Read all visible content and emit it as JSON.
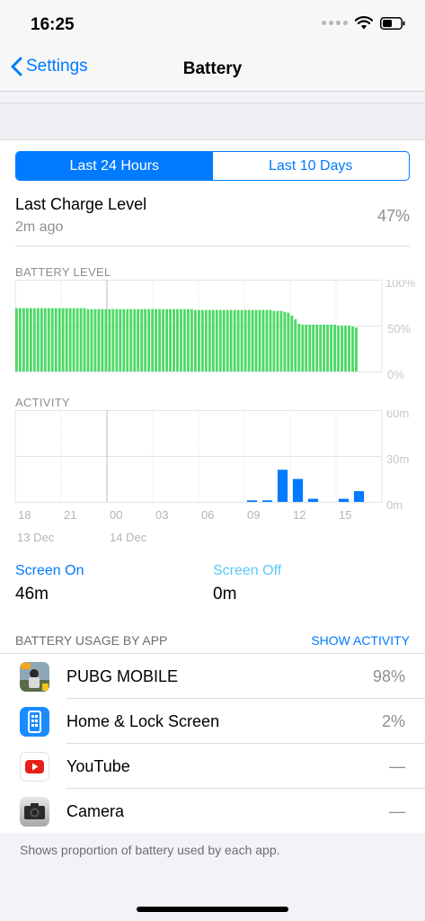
{
  "status": {
    "time": "16:25"
  },
  "nav": {
    "back_label": "Settings",
    "title": "Battery"
  },
  "tabs": [
    {
      "label": "Last 24 Hours",
      "active": true
    },
    {
      "label": "Last 10 Days",
      "active": false
    }
  ],
  "last_charge": {
    "title": "Last Charge Level",
    "time": "2m ago",
    "value": "47%"
  },
  "battery_level": {
    "label": "BATTERY LEVEL",
    "y_ticks": [
      "100%",
      "50%",
      "0%"
    ]
  },
  "activity": {
    "label": "ACTIVITY",
    "y_ticks": [
      "60m",
      "30m",
      "0m"
    ]
  },
  "x_ticks": [
    "18",
    "21",
    "00",
    "03",
    "06",
    "09",
    "12",
    "15"
  ],
  "dates": [
    "13 Dec",
    "14 Dec"
  ],
  "screen_on": {
    "label": "Screen On",
    "value": "46m"
  },
  "screen_off": {
    "label": "Screen Off",
    "value": "0m"
  },
  "usage": {
    "header": "BATTERY USAGE BY APP",
    "action": "SHOW ACTIVITY",
    "apps": [
      {
        "name": "PUBG MOBILE",
        "value": "98%",
        "icon": "pubg-icon"
      },
      {
        "name": "Home & Lock Screen",
        "value": "2%",
        "icon": "home-lock-icon"
      },
      {
        "name": "YouTube",
        "value": "—",
        "icon": "youtube-icon"
      },
      {
        "name": "Camera",
        "value": "—",
        "icon": "camera-icon"
      }
    ]
  },
  "footer": "Shows proportion of battery used by each app.",
  "colors": {
    "accent": "#007aff",
    "battery_green": "#4cd964",
    "screen_off": "#5ac8fa"
  },
  "chart_data": [
    {
      "type": "bar",
      "title": "BATTERY LEVEL",
      "y_ticks": [
        "100%",
        "50%",
        "0%"
      ],
      "ylim": [
        0,
        100
      ],
      "values": [
        69,
        69,
        69,
        69,
        69,
        69,
        69,
        69,
        69,
        69,
        69,
        69,
        69,
        69,
        69,
        69,
        69,
        69,
        69,
        69,
        68,
        68,
        68,
        68,
        68,
        68,
        68,
        68,
        68,
        68,
        68,
        68,
        68,
        68,
        68,
        68,
        68,
        68,
        68,
        68,
        68,
        68,
        68,
        68,
        68,
        68,
        68,
        68,
        68,
        68,
        67,
        67,
        67,
        67,
        67,
        67,
        67,
        67,
        67,
        67,
        67,
        67,
        67,
        67,
        67,
        67,
        67,
        67,
        67,
        67,
        67,
        67,
        66,
        66,
        66,
        65,
        64,
        61,
        57,
        52,
        51,
        51,
        51,
        51,
        51,
        51,
        51,
        51,
        51,
        51,
        50,
        50,
        50,
        50,
        49,
        48
      ]
    },
    {
      "type": "bar",
      "title": "ACTIVITY",
      "y_ticks": [
        "60m",
        "30m",
        "0m"
      ],
      "ylim": [
        0,
        60
      ],
      "categories": [
        "18",
        "19",
        "20",
        "21",
        "22",
        "23",
        "00",
        "01",
        "02",
        "03",
        "04",
        "05",
        "06",
        "07",
        "08",
        "09",
        "10",
        "11",
        "12",
        "13",
        "14",
        "15",
        "16",
        "17"
      ],
      "series": [
        {
          "values": [
            0,
            0,
            0,
            0,
            0,
            0,
            0,
            0,
            0,
            0,
            0,
            0,
            0,
            0,
            0,
            1,
            1,
            21,
            15,
            2,
            0,
            2,
            7,
            0
          ]
        }
      ]
    }
  ]
}
